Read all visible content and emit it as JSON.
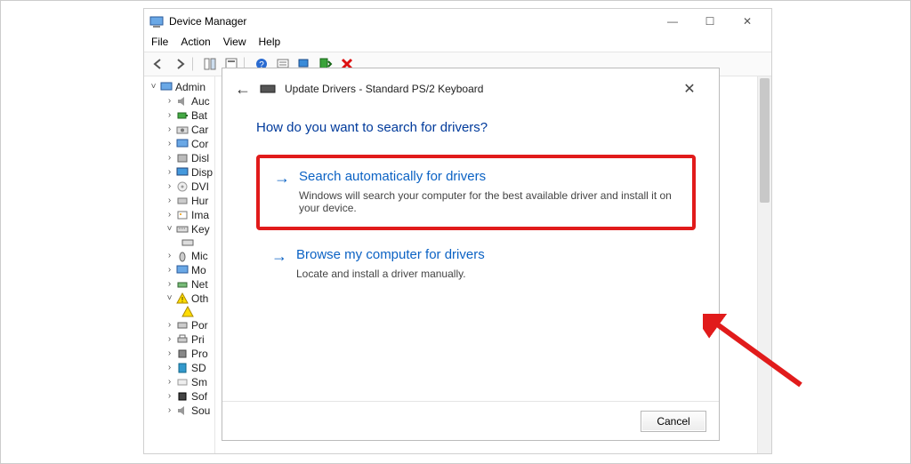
{
  "window": {
    "title": "Device Manager",
    "controls": {
      "min": "—",
      "max": "☐",
      "close": "✕"
    }
  },
  "menu": {
    "file": "File",
    "action": "Action",
    "view": "View",
    "help": "Help"
  },
  "toolbar": {
    "back": "back",
    "fwd": "forward",
    "show": "show-hidden",
    "props": "properties",
    "help": "help",
    "scan": "scan",
    "monitor": "update",
    "enable": "enable",
    "delete": "delete"
  },
  "tree": {
    "root": "Admin",
    "items": [
      "Auc",
      "Bat",
      "Car",
      "Cor",
      "Disl",
      "Disp",
      "DVI",
      "Hur",
      "Ima",
      "Key",
      "",
      "Mic",
      "Mo",
      "Net",
      "Oth",
      "",
      "Por",
      "Pri",
      "Pro",
      "SD",
      "Sm",
      "Sof",
      "Sou"
    ]
  },
  "dialog": {
    "back": "←",
    "title": "Update Drivers - Standard PS/2 Keyboard",
    "close": "✕",
    "headline": "How do you want to search for drivers?",
    "opt1": {
      "arrow": "→",
      "title": "Search automatically for drivers",
      "desc": "Windows will search your computer for the best available driver and install it on your device."
    },
    "opt2": {
      "arrow": "→",
      "title": "Browse my computer for drivers",
      "desc": "Locate and install a driver manually."
    },
    "cancel": "Cancel"
  }
}
